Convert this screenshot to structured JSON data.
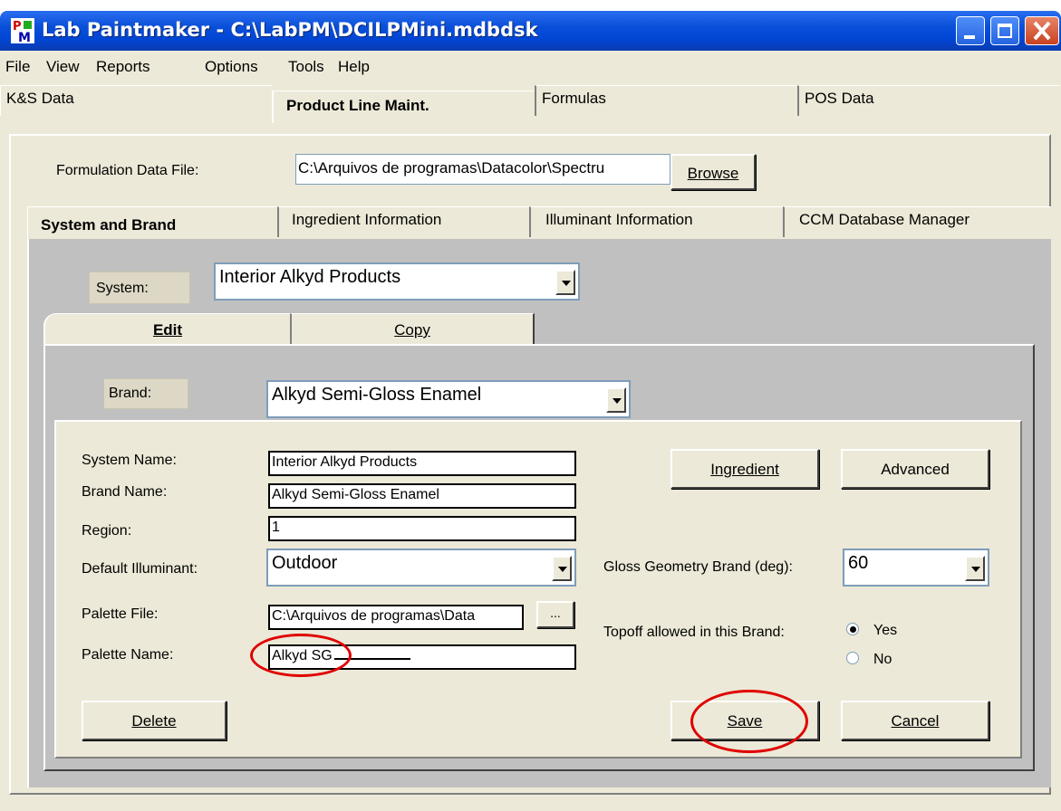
{
  "window": {
    "title": "Lab Paintmaker - C:\\LabPM\\DCILPMini.mdbdsk"
  },
  "menu": [
    "File",
    "View",
    "Reports",
    "Options",
    "Tools",
    "Help"
  ],
  "main_tabs": [
    "K&S Data",
    "Product Line Maint.",
    "Formulas",
    "POS Data"
  ],
  "formulation": {
    "label": "Formulation Data File:",
    "value": "C:\\Arquivos de programas\\Datacolor\\Spectru",
    "browse": "Browse"
  },
  "sub_tabs": [
    "System and Brand",
    "Ingredient Information",
    "Illuminant Information",
    "CCM Database Manager"
  ],
  "system": {
    "label": "System:",
    "value": "Interior Alkyd Products"
  },
  "edit_tabs": [
    "Edit",
    "Copy"
  ],
  "brand": {
    "label": "Brand:",
    "value": "Alkyd Semi-Gloss Enamel"
  },
  "form": {
    "system_name_label": "System Name:",
    "system_name": "Interior Alkyd Products",
    "brand_name_label": "Brand Name:",
    "brand_name": "Alkyd Semi-Gloss Enamel",
    "region_label": "Region:",
    "region": "1",
    "illuminant_label": "Default Illuminant:",
    "illuminant": "Outdoor",
    "palette_file_label": "Palette File:",
    "palette_file": "C:\\Arquivos de programas\\Data",
    "palette_file_browse": "...",
    "palette_name_label": "Palette Name:",
    "palette_name": "Alkyd SG",
    "ingredient_btn": "Ingredient",
    "advanced_btn": "Advanced",
    "gloss_label": "Gloss Geometry Brand (deg):",
    "gloss_value": "60",
    "topoff_label": "Topoff allowed in this Brand:",
    "topoff_yes": "Yes",
    "topoff_no": "No",
    "topoff_selected": "Yes",
    "delete_btn": "Delete",
    "save_btn": "Save",
    "cancel_btn": "Cancel"
  },
  "colors": {
    "titlebar": "#0046d5",
    "window_bg": "#ece9d8",
    "annotation": "#e00000"
  }
}
